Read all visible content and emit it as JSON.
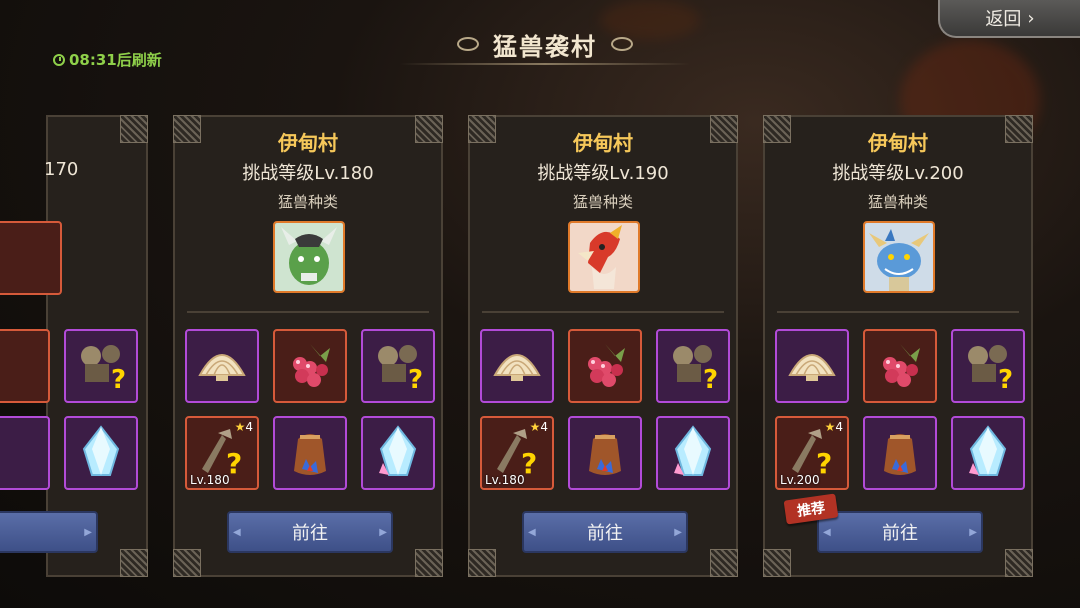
{
  "header": {
    "title": "猛兽袭村",
    "back_label": "返回",
    "refresh_text": "08:31后刷新"
  },
  "partial_card": {
    "level_text": "170"
  },
  "cards": [
    {
      "name": "伊甸村",
      "level": "挑战等级Lv.180",
      "type_label": "猛兽种类",
      "beast": "green-dragon",
      "gear_level": "Lv.180",
      "gear_stars": "4",
      "button": "前往",
      "recommended": ""
    },
    {
      "name": "伊甸村",
      "level": "挑战等级Lv.190",
      "type_label": "猛兽种类",
      "beast": "fire-bird",
      "gear_level": "Lv.180",
      "gear_stars": "4",
      "button": "前往",
      "recommended": ""
    },
    {
      "name": "伊甸村",
      "level": "挑战等级Lv.200",
      "type_label": "猛兽种类",
      "beast": "blue-dragon",
      "gear_level": "Lv.200",
      "gear_stars": "4",
      "button": "前往",
      "recommended": "推荐"
    }
  ],
  "reward_icons": [
    "shell-icon",
    "berries-icon",
    "mystery-gear-icon",
    "mystery-weapon-icon",
    "treasure-bag-icon",
    "crystal-icon"
  ],
  "colors": {
    "accent_gold": "#f6c85a",
    "refresh_green": "#8fd04a",
    "button_blue": "#4a5e98",
    "rare_purple": "#b24bd8",
    "epic_red": "#d65a3a"
  }
}
